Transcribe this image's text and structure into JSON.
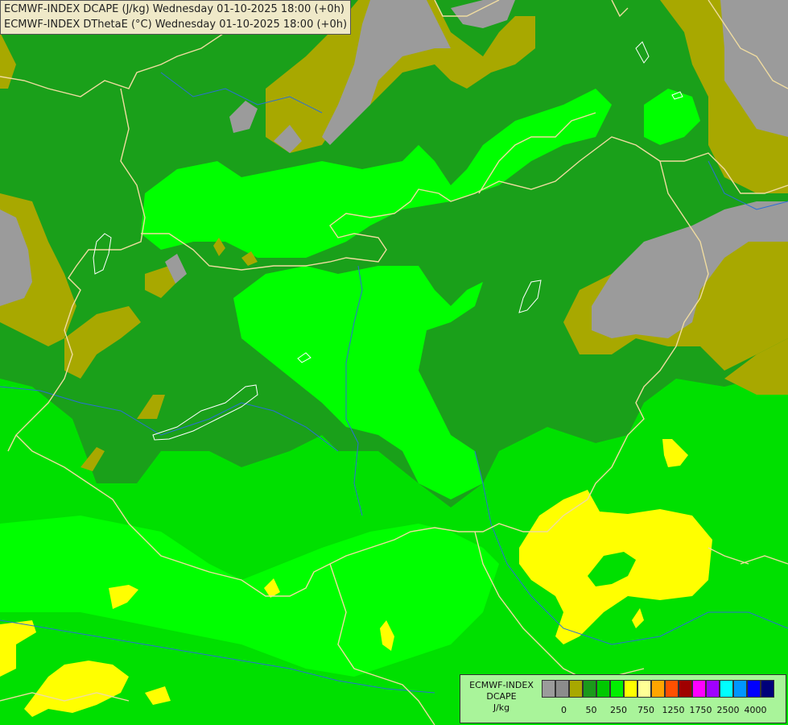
{
  "header": {
    "line1": "ECMWF-INDEX DCAPE (J/kg) Wednesday 01-10-2025 18:00 (+0h)",
    "line2": "ECMWF-INDEX DThetaE (°C) Wednesday 01-10-2025 18:00 (+0h)"
  },
  "legend": {
    "title_line1": "ECMWF-INDEX",
    "title_line2": "DCAPE",
    "title_line3": "J/kg",
    "colors": [
      "#9b9b9b",
      "#8c8c8c",
      "#a8a800",
      "#1b9a1b",
      "#00c800",
      "#00f000",
      "#ffff00",
      "#ffff96",
      "#ffa500",
      "#ff5000",
      "#a00000",
      "#ff00ff",
      "#a000ff",
      "#00ffff",
      "#0096ff",
      "#0000ff",
      "#00007a"
    ],
    "tick_labels": [
      "0",
      "50",
      "250",
      "750",
      "1250",
      "1750",
      "2500",
      "4000"
    ]
  },
  "map_colors": {
    "grey": "#9b9b9b",
    "olive": "#a8a800",
    "dark_green": "#1aa01a",
    "green": "#00e000",
    "light_green": "#00ff00",
    "yellow": "#ffff00",
    "border": "#f0dca0",
    "river": "#2b6fd6"
  }
}
